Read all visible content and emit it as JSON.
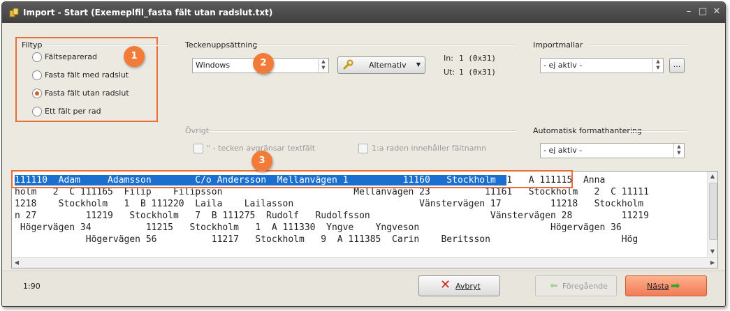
{
  "window": {
    "title": "Import - Start  (Exemeplfil_fasta fält utan radslut.txt)",
    "controls": [
      "–",
      "□",
      "✕"
    ]
  },
  "filetype": {
    "label": "Filtyp",
    "options": [
      {
        "label": "Fältseparerad",
        "checked": false
      },
      {
        "label": "Fasta fält med radslut",
        "checked": false
      },
      {
        "label": "Fasta fält utan radslut",
        "checked": true
      },
      {
        "label": "Ett fält per rad",
        "checked": false
      }
    ]
  },
  "charset": {
    "label": "Teckenuppsättning",
    "value": "Windows",
    "alternativ_label": "Alternativ",
    "in_label": "In:",
    "in_value": "1 (0x31)",
    "out_label": "Ut:",
    "out_value": "1 (0x31)"
  },
  "templates": {
    "label": "Importmallar",
    "value": "- ej aktiv -",
    "browse_label": "..."
  },
  "other": {
    "label": "Övrigt",
    "quote_label": "\" - tecken avgränsar textfält",
    "firstrow_label": "1:a raden innehåller fältnamn"
  },
  "autoformat": {
    "label": "Automatisk formathantering",
    "value": "- ej aktiv -"
  },
  "badges": [
    "1",
    "2",
    "3"
  ],
  "preview": {
    "selected": "111110  Adam     Adamsson        C/o Andersson  Mellanvägen 1          11160   Stockholm  ",
    "lines": [
      "1   A 111115  Anna",
      "holm   2  C 111165  Filip    Filipsson                        Mellanvägen 23          11161   Stockholm   2  C 11111",
      "1218    Stockholm   1  B 111220  Laila    Lailasson                       Vänstervägen 17         11218   Stockholm",
      "n 27         11219   Stockholm   7  B 111275  Rudolf   Rudolfsson                      Vänstervägen 28         11219",
      " Högervägen 34          11215   Stockholm   1  A 111330  Yngve    Yngveson                        Högervägen 36",
      "             Högervägen 56          11217   Stockholm   9  A 111385  Carin    Beritsson                        Hög"
    ]
  },
  "status": {
    "position": "1:90"
  },
  "buttons": {
    "cancel": "Avbryt",
    "previous": "Föregående",
    "next": "Nästa"
  }
}
